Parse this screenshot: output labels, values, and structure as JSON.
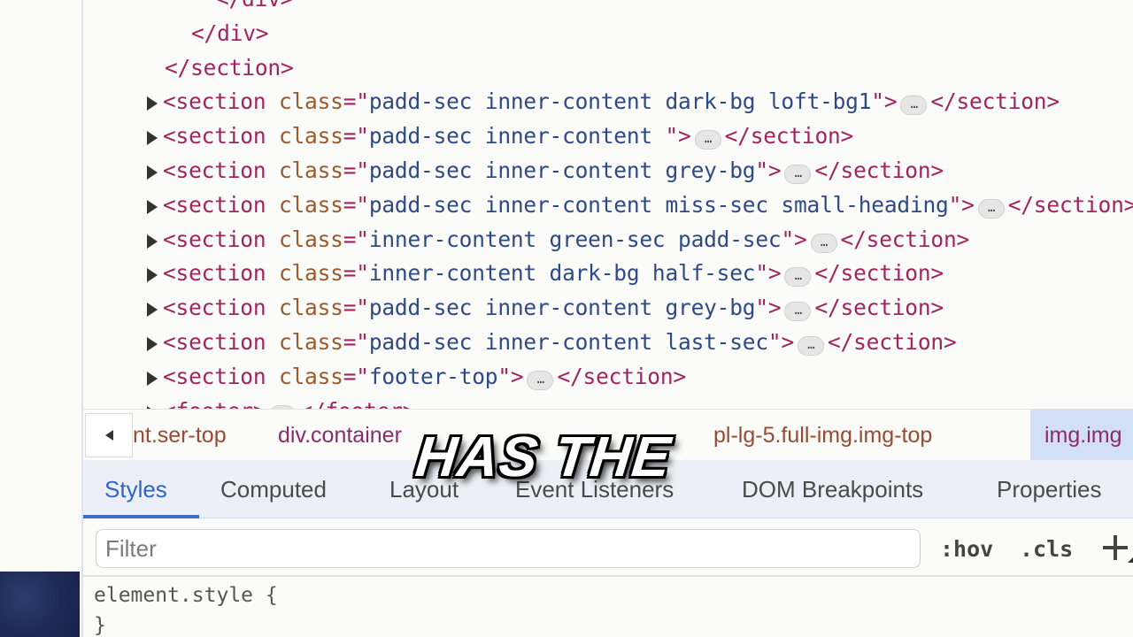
{
  "dom_tree": {
    "lines": [
      {
        "indent": 150,
        "parts": [
          [
            "tag",
            "</div>"
          ]
        ]
      },
      {
        "indent": 122,
        "parts": [
          [
            "tag",
            "</div>"
          ]
        ]
      },
      {
        "indent": 92,
        "parts": [
          [
            "tag",
            "</section>"
          ]
        ]
      },
      {
        "indent": 72,
        "expandable": true,
        "parts": [
          [
            "tag",
            "<section "
          ],
          [
            "attr",
            "class"
          ],
          [
            "tag",
            "=\""
          ],
          [
            "val",
            "padd-sec inner-content dark-bg loft-bg1"
          ],
          [
            "tag",
            "\">"
          ],
          [
            "ell",
            "…"
          ],
          [
            "tag",
            "</section>"
          ]
        ]
      },
      {
        "indent": 72,
        "expandable": true,
        "parts": [
          [
            "tag",
            "<section "
          ],
          [
            "attr",
            "class"
          ],
          [
            "tag",
            "=\""
          ],
          [
            "val",
            "padd-sec inner-content "
          ],
          [
            "tag",
            "\">"
          ],
          [
            "ell",
            "…"
          ],
          [
            "tag",
            "</section>"
          ]
        ]
      },
      {
        "indent": 72,
        "expandable": true,
        "parts": [
          [
            "tag",
            "<section "
          ],
          [
            "attr",
            "class"
          ],
          [
            "tag",
            "=\""
          ],
          [
            "val",
            "padd-sec inner-content grey-bg"
          ],
          [
            "tag",
            "\">"
          ],
          [
            "ell",
            "…"
          ],
          [
            "tag",
            "</section>"
          ]
        ]
      },
      {
        "indent": 72,
        "expandable": true,
        "parts": [
          [
            "tag",
            "<section "
          ],
          [
            "attr",
            "class"
          ],
          [
            "tag",
            "=\""
          ],
          [
            "val",
            "padd-sec inner-content miss-sec small-heading"
          ],
          [
            "tag",
            "\">"
          ],
          [
            "ell",
            "…"
          ],
          [
            "tag",
            "</section>"
          ]
        ]
      },
      {
        "indent": 72,
        "expandable": true,
        "parts": [
          [
            "tag",
            "<section "
          ],
          [
            "attr",
            "class"
          ],
          [
            "tag",
            "=\""
          ],
          [
            "val",
            "inner-content green-sec padd-sec"
          ],
          [
            "tag",
            "\">"
          ],
          [
            "ell",
            "…"
          ],
          [
            "tag",
            "</section>"
          ]
        ]
      },
      {
        "indent": 72,
        "expandable": true,
        "parts": [
          [
            "tag",
            "<section "
          ],
          [
            "attr",
            "class"
          ],
          [
            "tag",
            "=\""
          ],
          [
            "val",
            "inner-content dark-bg half-sec"
          ],
          [
            "tag",
            "\">"
          ],
          [
            "ell",
            "…"
          ],
          [
            "tag",
            "</section>"
          ]
        ]
      },
      {
        "indent": 72,
        "expandable": true,
        "parts": [
          [
            "tag",
            "<section "
          ],
          [
            "attr",
            "class"
          ],
          [
            "tag",
            "=\""
          ],
          [
            "val",
            "padd-sec inner-content grey-bg"
          ],
          [
            "tag",
            "\">"
          ],
          [
            "ell",
            "…"
          ],
          [
            "tag",
            "</section>"
          ]
        ]
      },
      {
        "indent": 72,
        "expandable": true,
        "parts": [
          [
            "tag",
            "<section "
          ],
          [
            "attr",
            "class"
          ],
          [
            "tag",
            "=\""
          ],
          [
            "val",
            "padd-sec inner-content last-sec"
          ],
          [
            "tag",
            "\">"
          ],
          [
            "ell",
            "…"
          ],
          [
            "tag",
            "</section>"
          ]
        ]
      },
      {
        "indent": 72,
        "expandable": true,
        "parts": [
          [
            "tag",
            "<section "
          ],
          [
            "attr",
            "class"
          ],
          [
            "tag",
            "=\""
          ],
          [
            "val",
            "footer-top"
          ],
          [
            "tag",
            "\">"
          ],
          [
            "ell",
            "…"
          ],
          [
            "tag",
            "</section>"
          ]
        ]
      },
      {
        "indent": 72,
        "expandable": true,
        "parts": [
          [
            "tag",
            "<footer>"
          ],
          [
            "ell",
            "…"
          ],
          [
            "tag",
            "</footer>"
          ]
        ]
      }
    ]
  },
  "breadcrumb": {
    "back_icon": "triangle-left-icon",
    "items": [
      "nt.ser-top",
      "div.container",
      "pl-lg-5.full-img.img-top",
      "img.img"
    ],
    "active_index": 3
  },
  "tabs": {
    "items": [
      "Styles",
      "Computed",
      "Layout",
      "Event Listeners",
      "DOM Breakpoints",
      "Properties"
    ],
    "active": "Styles"
  },
  "filter": {
    "placeholder": "Filter",
    "value": "",
    "hov_label": ":hov",
    "cls_label": ".cls",
    "add_rule_icon": "plus-icon"
  },
  "styles": {
    "rule_open": "element.style {",
    "rule_close": "}"
  },
  "caption": {
    "text": "HAS THE"
  }
}
